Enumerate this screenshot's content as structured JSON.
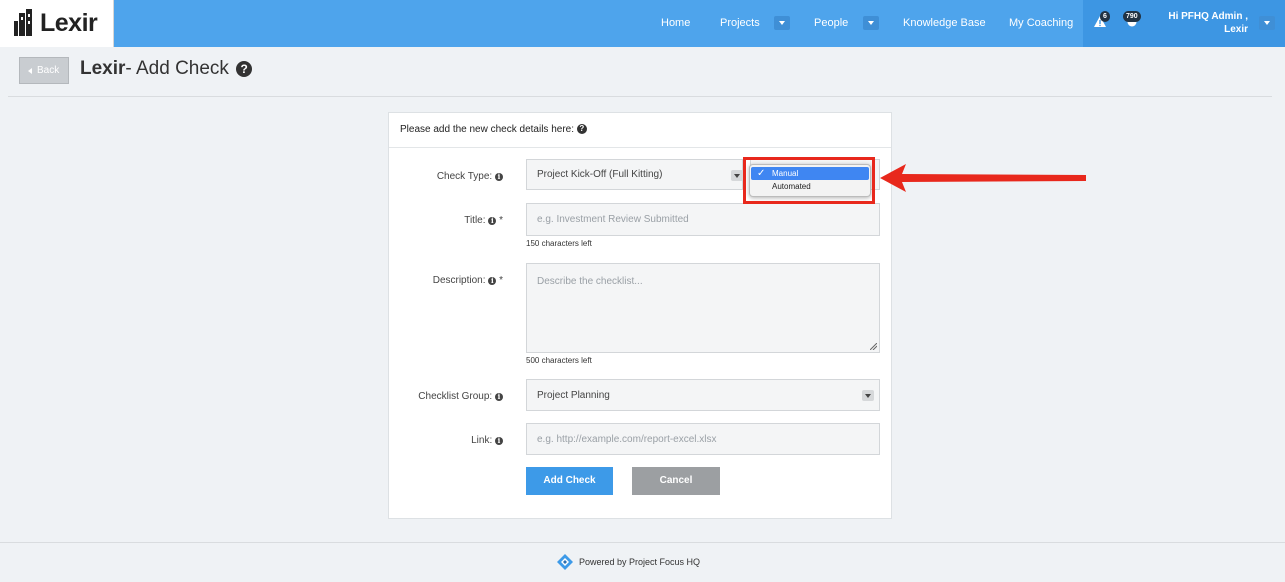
{
  "app": {
    "name": "Lexir"
  },
  "nav": {
    "items": [
      {
        "label": "Home"
      },
      {
        "label": "Projects"
      },
      {
        "label": "People"
      },
      {
        "label": "Knowledge Base"
      },
      {
        "label": "My Coaching"
      }
    ],
    "alerts_count": "6",
    "points_count": "790",
    "user_greeting_line1": "Hi PFHQ Admin ,",
    "user_greeting_line2": "Lexir"
  },
  "header": {
    "back_label": "Back",
    "title_brand": "Lexir",
    "title_rest": "- Add Check"
  },
  "form": {
    "heading": "Please add the new check details here:",
    "check_type": {
      "label": "Check Type:",
      "value": "Project Kick-Off (Full Kitting)"
    },
    "mode_dropdown": {
      "options": [
        "Manual",
        "Automated"
      ],
      "selected": "Manual"
    },
    "title": {
      "label": "Title:",
      "required": "*",
      "placeholder": "e.g. Investment Review Submitted",
      "help": "150 characters left"
    },
    "description": {
      "label": "Description:",
      "required": "*",
      "placeholder": "Describe the checklist...",
      "help": "500 characters left"
    },
    "checklist_group": {
      "label": "Checklist Group:",
      "value": "Project Planning"
    },
    "link": {
      "label": "Link:",
      "placeholder": "e.g. http://example.com/report-excel.xlsx"
    },
    "submit_label": "Add Check",
    "cancel_label": "Cancel"
  },
  "footer": {
    "text": "Powered by Project Focus HQ"
  },
  "colors": {
    "nav": "#4ea4ec",
    "primary_button": "#3d9ae8",
    "annotation": "#e8281c"
  }
}
